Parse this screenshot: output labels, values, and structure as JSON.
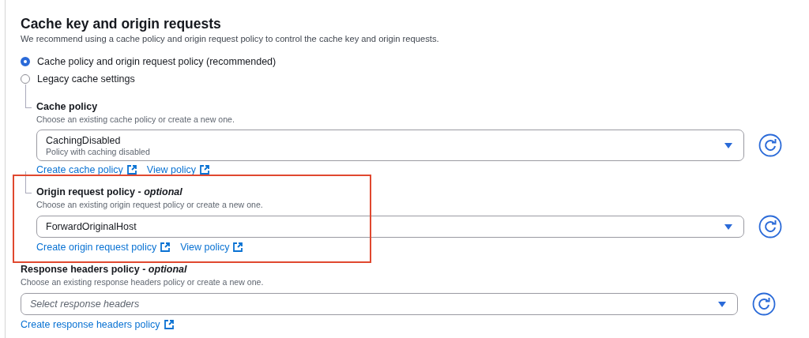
{
  "section": {
    "title": "Cache key and origin requests",
    "description": "We recommend using a cache policy and origin request policy to control the cache key and origin requests."
  },
  "options": [
    {
      "label": "Cache policy and origin request policy (recommended)",
      "selected": true
    },
    {
      "label": "Legacy cache settings",
      "selected": false
    }
  ],
  "fields": [
    {
      "label": "Cache policy",
      "nested": true,
      "highlighted": false,
      "description": "Choose an existing cache policy or create a new one.",
      "value": "CachingDisabled",
      "value_description": "Policy with caching disabled",
      "links": [
        "Create cache policy",
        "View policy"
      ]
    },
    {
      "label": "Origin request policy - *optional*",
      "nested": true,
      "highlighted": true,
      "description": "Choose an existing origin request policy or create a new one.",
      "value": "ForwardOriginalHost",
      "links": [
        "Create origin request policy",
        "View policy"
      ]
    },
    {
      "label": "Response headers policy - *optional*",
      "nested": false,
      "highlighted": false,
      "description": "Choose an existing response headers policy or create a new one.",
      "placeholder": "Select response headers",
      "links": [
        "Create response headers policy"
      ]
    }
  ]
}
